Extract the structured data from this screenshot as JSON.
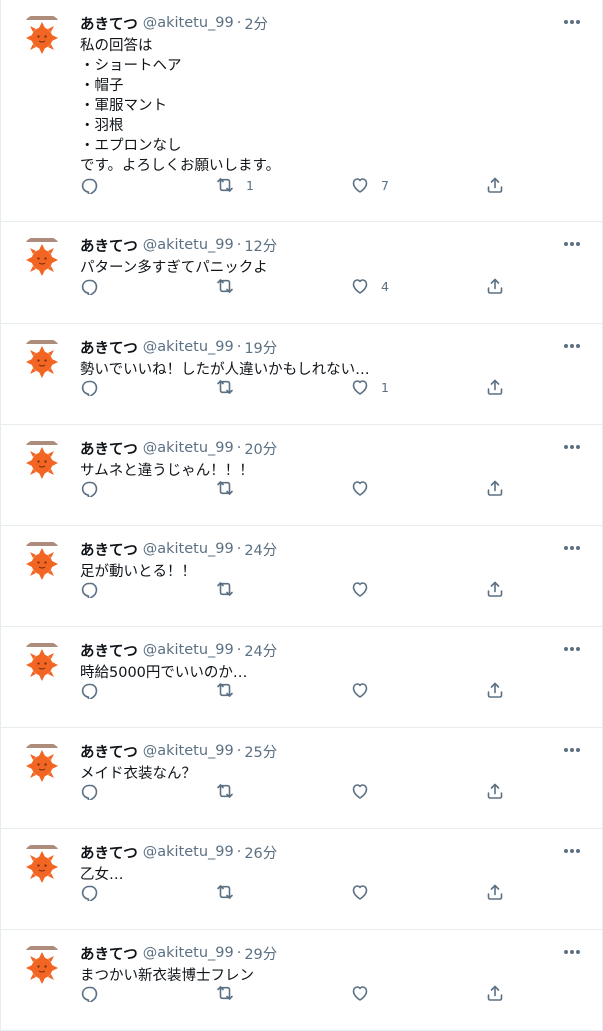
{
  "tweets": [
    {
      "name": "あきてつ",
      "handle": "@akitetu_99",
      "time": "2分",
      "lines": [
        "私の回答は",
        "・ショートヘア",
        "・帽子",
        "・軍服マント",
        "・羽根",
        "・エプロンなし",
        "です。よろしくお願いします。"
      ],
      "retweets": "1",
      "likes": "7"
    },
    {
      "name": "あきてつ",
      "handle": "@akitetu_99",
      "time": "12分",
      "lines": [
        "パターン多すぎてパニックよ"
      ],
      "retweets": "",
      "likes": "4"
    },
    {
      "name": "あきてつ",
      "handle": "@akitetu_99",
      "time": "19分",
      "lines": [
        "勢いでいいね！したが人違いかもしれない…"
      ],
      "retweets": "",
      "likes": "1"
    },
    {
      "name": "あきてつ",
      "handle": "@akitetu_99",
      "time": "20分",
      "lines": [
        "サムネと違うじゃん！！！"
      ],
      "retweets": "",
      "likes": ""
    },
    {
      "name": "あきてつ",
      "handle": "@akitetu_99",
      "time": "24分",
      "lines": [
        "足が動いとる！！"
      ],
      "retweets": "",
      "likes": ""
    },
    {
      "name": "あきてつ",
      "handle": "@akitetu_99",
      "time": "24分",
      "lines": [
        "時給5000円でいいのか…"
      ],
      "retweets": "",
      "likes": ""
    },
    {
      "name": "あきてつ",
      "handle": "@akitetu_99",
      "time": "25分",
      "lines": [
        "メイド衣装なん？"
      ],
      "retweets": "",
      "likes": ""
    },
    {
      "name": "あきてつ",
      "handle": "@akitetu_99",
      "time": "26分",
      "lines": [
        "乙女…"
      ],
      "retweets": "",
      "likes": ""
    },
    {
      "name": "あきてつ",
      "handle": "@akitetu_99",
      "time": "29分",
      "lines": [
        "まつかい新衣装博士フレン"
      ],
      "retweets": "",
      "likes": ""
    }
  ],
  "separator": "·",
  "icons": {
    "reply": "reply-icon",
    "retweet": "retweet-icon",
    "like": "heart-icon",
    "share": "share-icon",
    "more": "more-icon"
  },
  "colors": {
    "icon": "#5b7083",
    "border": "#e6ecf0",
    "avatar": "#f26522",
    "text": "#0f1419"
  }
}
